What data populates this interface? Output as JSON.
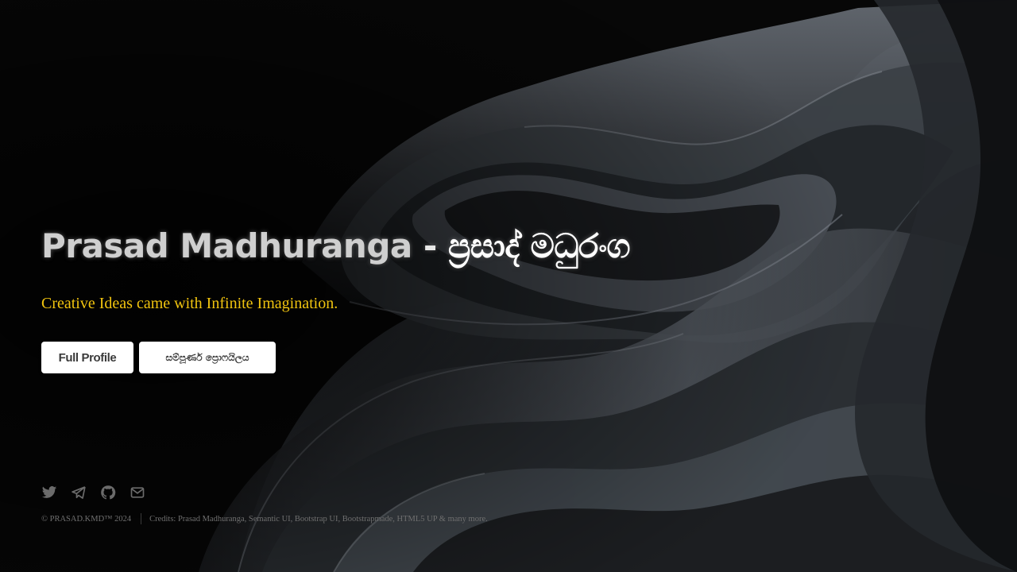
{
  "hero": {
    "title_en": "Prasad Madhuranga",
    "title_sep": " - ",
    "title_si": "ප්‍රසාද් මධුරංග",
    "tagline": "Creative Ideas came with Infinite Imagination."
  },
  "buttons": {
    "full_profile": "Full Profile",
    "full_profile_si": "සම්පූර්ණ ප්‍රොෆයිලය"
  },
  "social": [
    {
      "icon": "twitter-icon"
    },
    {
      "icon": "telegram-icon"
    },
    {
      "icon": "github-icon"
    },
    {
      "icon": "mail-icon"
    }
  ],
  "footer": {
    "copyright": "© PRASAD.KMD™ 2024",
    "credits": "Credits: Prasad Madhuranga, Semantic UI, Bootstrap UI, Bootstrapmade, HTML5 UP & many more."
  },
  "colors": {
    "tagline": "#f1c40f",
    "background": "#060606",
    "button_bg": "#ffffff"
  }
}
